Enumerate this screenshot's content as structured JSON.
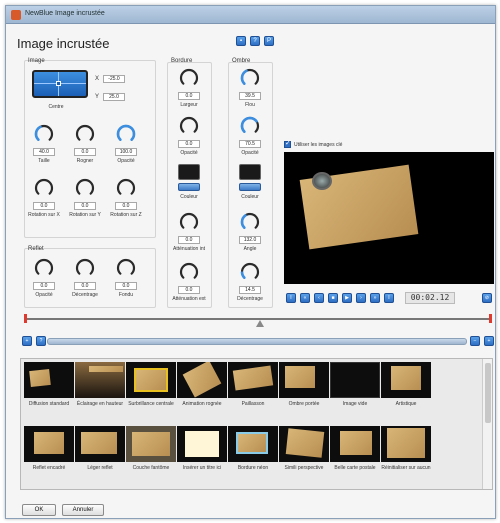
{
  "window": {
    "title": "NewBlue Image incrustée"
  },
  "heading": "Image incrustée",
  "toolbar_top": [
    {
      "icon": "save-icon",
      "label": ""
    },
    {
      "icon": "help-icon",
      "label": "?"
    },
    {
      "icon": "preset-icon",
      "label": "P"
    }
  ],
  "image": {
    "label": "Image",
    "position_label": "Centre",
    "x_label": "X",
    "x_value": "-25.0",
    "y_label": "Y",
    "y_value": "25.0",
    "knobs": [
      {
        "label": "Taille",
        "value": "40.0",
        "level": 0.4
      },
      {
        "label": "Rogner",
        "value": "0.0",
        "level": 0.0
      },
      {
        "label": "Opacité",
        "value": "100.0",
        "level": 1.0
      },
      {
        "label": "Rotation sur X",
        "value": "0.0",
        "level": 0.0
      },
      {
        "label": "Rotation sur Y",
        "value": "0.0",
        "level": 0.0
      },
      {
        "label": "Rotation sur Z",
        "value": "0.0",
        "level": 0.0
      }
    ]
  },
  "reflet": {
    "label": "Reflet",
    "knobs": [
      {
        "label": "Opacité",
        "value": "0.0",
        "level": 0.0
      },
      {
        "label": "Décentrage",
        "value": "0.0",
        "level": 0.0
      },
      {
        "label": "Fondu",
        "value": "0.0",
        "level": 0.0
      }
    ]
  },
  "bordure": {
    "label": "Bordure",
    "largeur": {
      "label": "Largeur",
      "value": "0.0",
      "level": 0.0
    },
    "opacite": {
      "label": "Opacité",
      "value": "0.0",
      "level": 0.0
    },
    "couleur": {
      "label": "Couleur",
      "color": "#1a1a1a"
    },
    "att_int": {
      "label": "Atténuation int",
      "value": "0.0",
      "level": 0.0
    },
    "att_ext": {
      "label": "Atténuation ext",
      "value": "0.0",
      "level": 0.0
    }
  },
  "ombre": {
    "label": "Ombre",
    "flou": {
      "label": "Flou",
      "value": "39.5",
      "level": 0.4
    },
    "opacite": {
      "label": "Opacité",
      "value": "70.5",
      "level": 0.7
    },
    "couleur": {
      "label": "Couleur",
      "color": "#1a1a1a"
    },
    "angle": {
      "label": "Angle",
      "value": "132.0",
      "level": 0.37
    },
    "decentrage": {
      "label": "Décentrage",
      "value": "14.5",
      "level": 0.15
    }
  },
  "preview": {
    "use_clips_label": "Utiliser les images clé",
    "use_clips_checked": true
  },
  "transport": {
    "timecode": "00:02.12",
    "buttons": [
      "I",
      "«",
      "‹",
      "■",
      "▶",
      "›",
      "»",
      "I"
    ]
  },
  "timeline_toolbar": {
    "left_buttons": [
      "+",
      "?"
    ],
    "right_buttons": [
      "−",
      "+"
    ]
  },
  "presets": [
    {
      "name": "Diffusion standard"
    },
    {
      "name": "Éclairage en hauteur"
    },
    {
      "name": "Surbrillance centrale"
    },
    {
      "name": "Animation rognée"
    },
    {
      "name": "Paillasson"
    },
    {
      "name": "Ombre portée"
    },
    {
      "name": "Image vide"
    },
    {
      "name": "Artistique"
    },
    {
      "name": "Reflet encadré"
    },
    {
      "name": "Léger reflet"
    },
    {
      "name": "Couche fantôme"
    },
    {
      "name": "Insérer un titre ici"
    },
    {
      "name": "Bordure néon"
    },
    {
      "name": "Simili perspective"
    },
    {
      "name": "Belle carte postale"
    },
    {
      "name": "Réinitialiser sur aucun"
    }
  ],
  "buttons": {
    "ok": "OK",
    "cancel": "Annuler"
  },
  "colors": {
    "accent": "#2f6fc4",
    "knob": "#2a2a2a",
    "knob_active": "#3b8ee0",
    "timeline_marker": "#e03a2e"
  }
}
